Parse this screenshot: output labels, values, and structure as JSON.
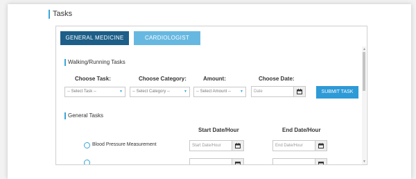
{
  "page": {
    "title": "Tasks"
  },
  "tabs": [
    {
      "label": "GENERAL MEDICINE",
      "active": true
    },
    {
      "label": "CARDIOLOGIST",
      "active": false
    }
  ],
  "walking": {
    "section_title": "Walking/Running Tasks",
    "labels": {
      "task": "Choose Task:",
      "category": "Choose Category:",
      "amount": "Amount:",
      "date": "Choose Date:"
    },
    "task_select": "-- Select Task --",
    "category_select": "-- Select Category --",
    "amount_select": "-- Select Amount --",
    "date_placeholder": "Date",
    "submit_label": "SUBMIT TASK"
  },
  "general": {
    "section_title": "General Tasks",
    "start_header": "Start Date/Hour",
    "end_header": "End Date/Hour",
    "rows": [
      {
        "label": "Blood Pressure Measurement",
        "start_placeholder": "Start Date/Hour",
        "end_placeholder": "End Date/Hour"
      }
    ]
  },
  "icons": {
    "calendar": "calendar-icon",
    "dropdown": "chevron-down-icon",
    "scroll_up": "triangle-up",
    "scroll_down": "triangle-down"
  },
  "colors": {
    "accent": "#3aa5d8",
    "tab_active": "#1d5f88",
    "tab_inactive": "#67b8e0",
    "submit": "#2e9ad6"
  }
}
